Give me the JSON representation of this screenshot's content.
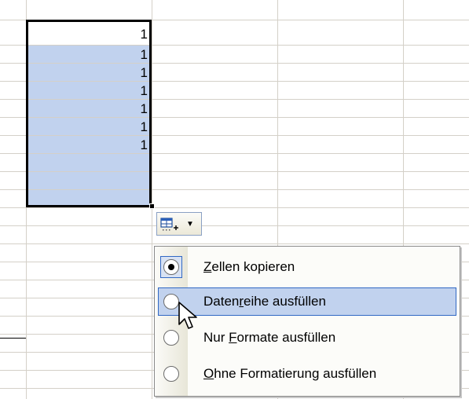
{
  "sheet": {
    "cells": [
      "1",
      "1",
      "1",
      "1",
      "1",
      "1",
      "1"
    ],
    "selection_fill": "#c1d2ee",
    "grid_color": "#d4d0c8"
  },
  "smart_tag": {
    "icon": "autofill-options-icon",
    "arrow_icon": "dropdown-arrow-icon"
  },
  "menu": {
    "items": [
      {
        "pre": "",
        "key": "Z",
        "post": "ellen kopieren",
        "checked": true
      },
      {
        "pre": "Daten",
        "key": "r",
        "post": "eihe ausfüllen",
        "hover": true
      },
      {
        "pre": "Nur ",
        "key": "F",
        "post": "ormate ausfüllen"
      },
      {
        "pre": "",
        "key": "O",
        "post": "hne Formatierung ausfüllen"
      }
    ],
    "highlight_color": "#c1d2ee",
    "border_color": "#3168c4"
  },
  "cursor": {
    "icon": "arrow-cursor-icon"
  }
}
